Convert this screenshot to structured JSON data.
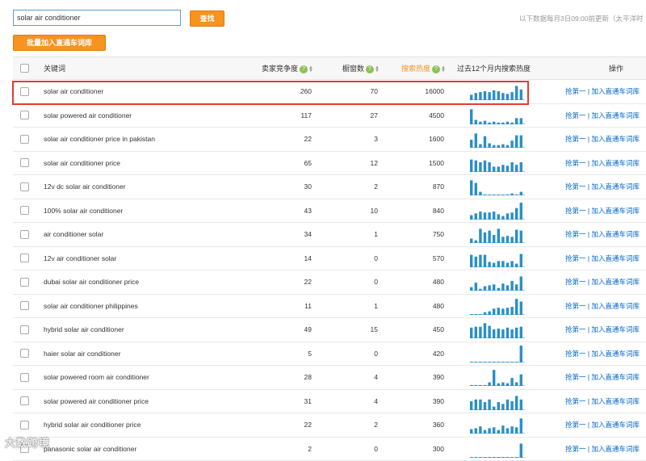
{
  "search": {
    "value": "solar air conditioner",
    "button_label": "查找"
  },
  "update_note": "以下数据每月3日09:00前更新（太平洋时",
  "bulk_add_label": "批量加入直通车词库",
  "table": {
    "headers": {
      "keyword": "关键词",
      "competition": "卖家竞争度",
      "showcase": "橱窗数",
      "heat": "搜索热度",
      "trend": "过去12个月内搜索热度",
      "action": "操作"
    },
    "action_first": "抢第一",
    "action_sep": "|",
    "action_add": "加入直通车词库",
    "rows": [
      {
        "keyword": "solar air conditioner",
        "competition": "260",
        "showcase": "70",
        "heat": "16000",
        "trend": [
          30,
          40,
          45,
          50,
          45,
          55,
          50,
          40,
          35,
          45,
          80,
          60
        ]
      },
      {
        "keyword": "solar powered air conditioner",
        "competition": "117",
        "showcase": "27",
        "heat": "4500",
        "trend": [
          85,
          25,
          15,
          20,
          10,
          15,
          10,
          10,
          15,
          10,
          35,
          35
        ]
      },
      {
        "keyword": "solar air conditioner price in pakistan",
        "competition": "22",
        "showcase": "3",
        "heat": "1600",
        "trend": [
          45,
          80,
          20,
          65,
          25,
          15,
          15,
          20,
          15,
          40,
          70,
          70
        ]
      },
      {
        "keyword": "solar air conditioner price",
        "competition": "65",
        "showcase": "12",
        "heat": "1500",
        "trend": [
          70,
          65,
          55,
          65,
          55,
          30,
          30,
          40,
          35,
          55,
          40,
          55
        ]
      },
      {
        "keyword": "12v dc solar air conditioner",
        "competition": "30",
        "showcase": "2",
        "heat": "870",
        "trend": [
          85,
          70,
          20,
          5,
          2,
          2,
          2,
          2,
          5,
          10,
          5,
          20
        ]
      },
      {
        "keyword": "100% solar air conditioner",
        "competition": "43",
        "showcase": "10",
        "heat": "840",
        "trend": [
          25,
          35,
          45,
          40,
          40,
          45,
          30,
          20,
          35,
          40,
          65,
          95
        ]
      },
      {
        "keyword": "air conditioner solar",
        "competition": "34",
        "showcase": "1",
        "heat": "750",
        "trend": [
          25,
          15,
          80,
          60,
          70,
          45,
          80,
          35,
          40,
          35,
          75,
          70
        ]
      },
      {
        "keyword": "12v air conditioner solar",
        "competition": "14",
        "showcase": "0",
        "heat": "570",
        "trend": [
          70,
          60,
          70,
          70,
          30,
          25,
          35,
          35,
          25,
          35,
          20,
          75
        ]
      },
      {
        "keyword": "dubai solar air conditioner price",
        "competition": "22",
        "showcase": "0",
        "heat": "480",
        "trend": [
          20,
          45,
          10,
          25,
          30,
          35,
          15,
          40,
          30,
          55,
          35,
          80
        ]
      },
      {
        "keyword": "solar air conditioner philippines",
        "competition": "11",
        "showcase": "1",
        "heat": "480",
        "trend": [
          3,
          3,
          3,
          15,
          20,
          35,
          40,
          35,
          40,
          45,
          90,
          75
        ]
      },
      {
        "keyword": "hybrid solar air conditioner",
        "competition": "49",
        "showcase": "15",
        "heat": "450",
        "trend": [
          60,
          65,
          65,
          85,
          70,
          50,
          55,
          50,
          60,
          50,
          60,
          65
        ]
      },
      {
        "keyword": "haier solar air conditioner",
        "competition": "5",
        "showcase": "0",
        "heat": "420",
        "trend": [
          3,
          3,
          3,
          3,
          3,
          3,
          3,
          3,
          3,
          3,
          3,
          95
        ]
      },
      {
        "keyword": "solar powered room air conditioner",
        "competition": "28",
        "showcase": "4",
        "heat": "390",
        "trend": [
          5,
          5,
          5,
          5,
          20,
          90,
          15,
          20,
          15,
          45,
          20,
          65
        ]
      },
      {
        "keyword": "solar powered air conditioner price",
        "competition": "31",
        "showcase": "4",
        "heat": "390",
        "trend": [
          50,
          60,
          60,
          45,
          60,
          20,
          45,
          35,
          60,
          50,
          80,
          60
        ]
      },
      {
        "keyword": "hybrid solar air conditioner price",
        "competition": "22",
        "showcase": "2",
        "heat": "360",
        "trend": [
          25,
          30,
          40,
          20,
          30,
          35,
          20,
          45,
          30,
          40,
          35,
          85
        ]
      },
      {
        "keyword": "panasonic solar air conditioner",
        "competition": "2",
        "showcase": "0",
        "heat": "300",
        "trend": [
          3,
          3,
          3,
          3,
          3,
          3,
          3,
          3,
          3,
          3,
          3,
          80
        ]
      }
    ]
  },
  "watermark": "大数跨境",
  "colors": {
    "accent_button": "#f7931e",
    "link": "#0066cc",
    "spark_bar": "#2a8fc7",
    "highlight_border": "#e53935",
    "help_icon": "#8cc152"
  }
}
